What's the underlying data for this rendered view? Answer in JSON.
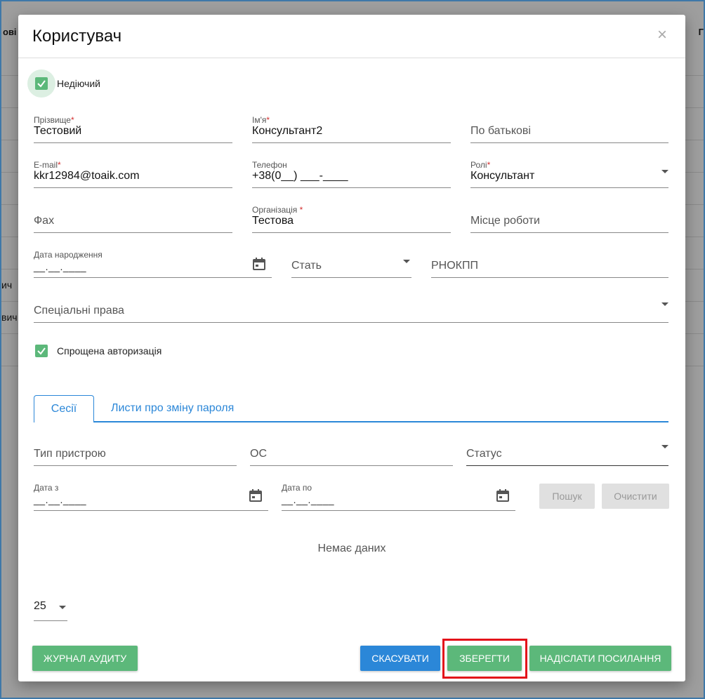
{
  "background": {
    "col_head_left": "ові",
    "col_head_right": "Г",
    "row_texts": [
      "ич",
      "вич"
    ]
  },
  "dialog": {
    "title": "Користувач",
    "close_glyph": "×",
    "inactive_checkbox": {
      "label": "Недіючий",
      "checked": true
    },
    "fields": {
      "surname": {
        "label": "Прізвище",
        "required_mark": "*",
        "value": "Тестовий"
      },
      "name": {
        "label": "Ім'я",
        "required_mark": "*",
        "value": "Консультант2"
      },
      "patronymic": {
        "placeholder": "По батькові"
      },
      "email": {
        "label": "E-mail",
        "required_mark": "*",
        "value": "kkr12984@toaik.com"
      },
      "phone": {
        "label": "Телефон",
        "value": "+38(0__) ___-____"
      },
      "roles": {
        "label": "Ролі",
        "required_mark": "*",
        "value": "Консультант"
      },
      "fax": {
        "placeholder": "Фах"
      },
      "organization": {
        "label": "Організація ",
        "required_mark": "*",
        "value": "Тестова"
      },
      "workplace": {
        "placeholder": "Місце роботи"
      },
      "birth_date": {
        "label": "Дата народження",
        "value": "__.__.____"
      },
      "gender": {
        "placeholder": "Стать"
      },
      "rnokpp": {
        "placeholder": "РНОКПП"
      },
      "special_rights": {
        "placeholder": "Спеціальні права"
      }
    },
    "simplified_auth": {
      "label": "Спрощена авторизація",
      "checked": true
    },
    "tabs": [
      "Сесії",
      "Листи про зміну пароля"
    ],
    "sessions_filter": {
      "device_type": {
        "placeholder": "Тип пристрою"
      },
      "os": {
        "placeholder": "ОС"
      },
      "status": {
        "placeholder": "Статус"
      },
      "date_from": {
        "label": "Дата з",
        "value": "__.__.____"
      },
      "date_to": {
        "label": "Дата по",
        "value": "__.__.____"
      },
      "search_label": "Пошук",
      "clear_label": "Очистити"
    },
    "no_data": "Немає даних",
    "page_size": "25",
    "footer": {
      "audit_label": "Журнал аудиту",
      "cancel_label": "Скасувати",
      "save_label": "Зберегти",
      "send_link_label": "Надіслати посилання"
    }
  },
  "colors": {
    "accent_blue": "#2b87d8",
    "accent_green": "#5cb87a",
    "highlight_red": "#e3101a"
  }
}
